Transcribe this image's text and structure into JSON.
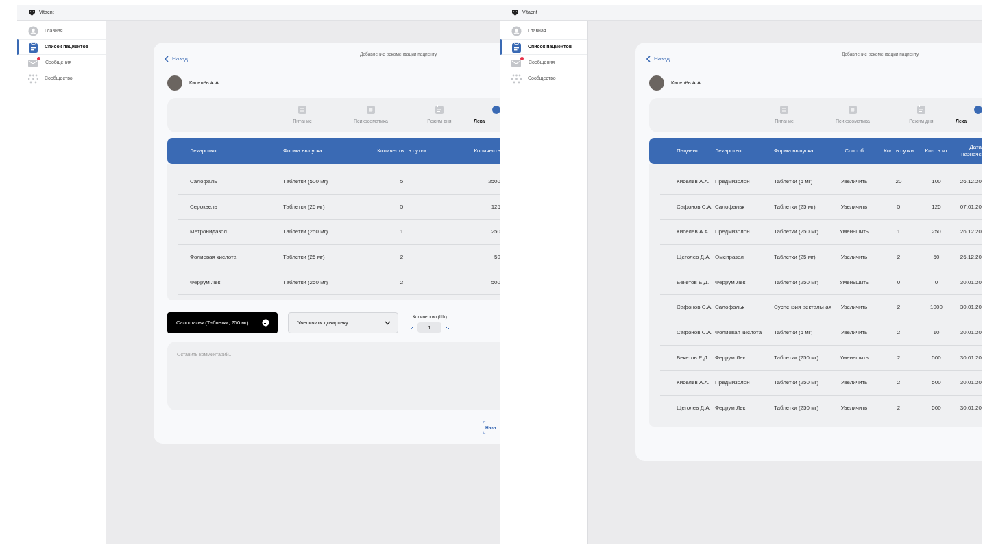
{
  "screens": [
    {
      "app_name": "Vitaent",
      "sidebar": [
        {
          "kind": "home",
          "label": "Главная",
          "selected": false,
          "unread": false
        },
        {
          "kind": "patients",
          "label": "Список пациентов",
          "selected": true,
          "unread": false
        },
        {
          "kind": "messages",
          "label": "Сообщения",
          "selected": false,
          "unread": true
        },
        {
          "kind": "community",
          "label": "Сообщество",
          "selected": false,
          "unread": false
        }
      ],
      "card": {
        "back": "Назад",
        "title": "Добавление рекомендации пациенту",
        "patient": "Киселёв А.А.",
        "tabs": [
          {
            "kind": "food",
            "label": "Питание",
            "selected": false
          },
          {
            "kind": "psycho",
            "label": "Психосоматика",
            "selected": false
          },
          {
            "kind": "schedule",
            "label": "Режим дня",
            "selected": false
          },
          {
            "kind": "drugs",
            "label": "Лека",
            "selected": true
          }
        ],
        "table": {
          "kind": "prescription",
          "columns": [
            "Лекарство",
            "Форма выпуска",
            "Количество в сутки",
            "Количеств"
          ],
          "rows": [
            [
              "Салофаль",
              "Таблетки (500 мг)",
              "5",
              "2500"
            ],
            [
              "Сероквель",
              "Таблетки (25 мг)",
              "5",
              "125"
            ],
            [
              "Метронидазол",
              "Таблетки (250 мг)",
              "1",
              "250"
            ],
            [
              "Фолиевая кислота",
              "Таблетки (25 мг)",
              "2",
              "50"
            ],
            [
              "Феррум Лек",
              "Таблетки (250 мг)",
              "2",
              "500"
            ]
          ]
        },
        "selected_drug": "Салофальк (Таблетки, 250 мг)",
        "dosage_select": "Увеличить дозировку",
        "quantity": {
          "label": "Количество (Шт)",
          "value": "1"
        },
        "comment": {
          "placeholder": "Оставить комментарий..."
        },
        "submit": "Назн"
      }
    },
    {
      "app_name": "Vitaent",
      "sidebar": [
        {
          "kind": "home",
          "label": "Главная",
          "selected": false,
          "unread": false
        },
        {
          "kind": "patients",
          "label": "Список пациентов",
          "selected": true,
          "unread": false
        },
        {
          "kind": "messages",
          "label": "Сообщения",
          "selected": false,
          "unread": true
        },
        {
          "kind": "community",
          "label": "Сообщество",
          "selected": false,
          "unread": false
        }
      ],
      "card": {
        "back": "Назад",
        "title": "Добавление рекомендации пациенту",
        "patient": "Киселёв А.А.",
        "tabs": [
          {
            "kind": "food",
            "label": "Питание",
            "selected": false
          },
          {
            "kind": "psycho",
            "label": "Психосоматика",
            "selected": false
          },
          {
            "kind": "schedule",
            "label": "Режим дня",
            "selected": false
          },
          {
            "kind": "drugs",
            "label": "Лека",
            "selected": true
          }
        ],
        "table": {
          "kind": "overview",
          "columns": [
            "Пациент",
            "Лекарство",
            "Форма выпуска",
            "Способ",
            "Кол. в сутки",
            "Кол. в мг",
            "Дата назначе"
          ],
          "rows": [
            [
              "Киселев А.А.",
              "Предмизолон",
              "Таблетки (5 мг)",
              "Увеличить",
              "20",
              "100",
              "26.12.20"
            ],
            [
              "Сафонов С.А.",
              "Салофальк",
              "Таблетки (25 мг)",
              "Увеличить",
              "5",
              "125",
              "07.01.20"
            ],
            [
              "Киселев А.А.",
              "Предмизолон",
              "Таблетки (250 мг)",
              "Уменьшить",
              "1",
              "250",
              "26.12.20"
            ],
            [
              "Щеголев Д.А.",
              "Омепразол",
              "Таблетки (25 мг)",
              "Увеличить",
              "2",
              "50",
              "26.12.20"
            ],
            [
              "Бекетов Е.Д.",
              "Феррум Лек",
              "Таблетки (250 мг)",
              "Уменьшить",
              "0",
              "0",
              "30.01.20"
            ],
            [
              "Сафонов С.А.",
              "Салофальк",
              "Суспензия ректальная",
              "Увеличить",
              "2",
              "1000",
              "30.01.20"
            ],
            [
              "Сафонов С.А.",
              "Фолиевая кислота",
              "Таблетки (5 мг)",
              "Увеличить",
              "2",
              "10",
              "30.01.20"
            ],
            [
              "Бекетов Е.Д.",
              "Феррум Лек",
              "Таблетки (250 мг)",
              "Уменьшить",
              "2",
              "500",
              "30.01.20"
            ],
            [
              "Киселев А.А.",
              "Предмизолон",
              "Таблетки (250 мг)",
              "Увеличить",
              "2",
              "500",
              "30.01.20"
            ],
            [
              "Щеголев Д.А.",
              "Феррум Лек",
              "Таблетки (250 мг)",
              "Увеличить",
              "2",
              "500",
              "30.01.20"
            ]
          ]
        }
      }
    }
  ]
}
